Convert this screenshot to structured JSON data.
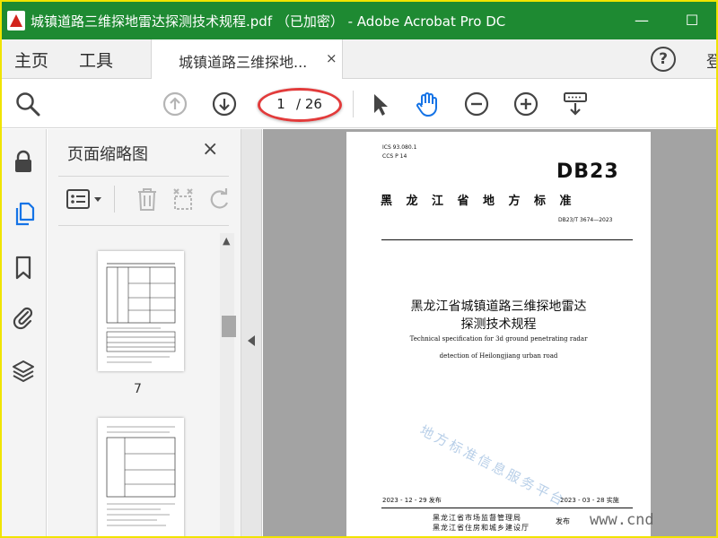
{
  "window": {
    "title": "城镇道路三维探地雷达探测技术规程.pdf （已加密） - Adobe Acrobat Pro DC",
    "minimize": "—",
    "maximize": "☐"
  },
  "menu": {
    "home": "主页",
    "tools": "工具",
    "doc_tab": "城镇道路三维探地...",
    "doc_tab_close": "×",
    "help": "?",
    "login": "登"
  },
  "toolbar": {
    "current_page": "1",
    "total_pages": "/ 26"
  },
  "panel": {
    "title": "页面缩略图",
    "close": "×",
    "thumbnails": [
      {
        "label": "7"
      }
    ]
  },
  "document": {
    "ics": "ICS 93.080.1",
    "ccs": "CCS P 14",
    "db_mark": "DB23",
    "standard_type": "黑龙江省地方标准",
    "code": "DB23/T 3674—2023",
    "title_line1": "黑龙江省城镇道路三维探地雷达",
    "title_line2": "探测技术规程",
    "en_line1": "Technical specification for 3d ground penetrating radar",
    "en_line2": "detection of Heilongjiang urban road",
    "watermark": "地方标准信息服务平台",
    "issue_date": "2023 - 12 - 29 发布",
    "effective_date": "2023 - 03 - 28 实施",
    "publisher1": "黑龙江省市场监督管理局",
    "publisher2": "黑龙江省住房和城乡建设厅",
    "issue": "发布"
  },
  "overlay_watermark": "www.cnd",
  "colors": {
    "titlebar": "#1e8a32",
    "frame": "#f0e400",
    "annotation": "#e23b3b",
    "accent": "#1473e6"
  }
}
